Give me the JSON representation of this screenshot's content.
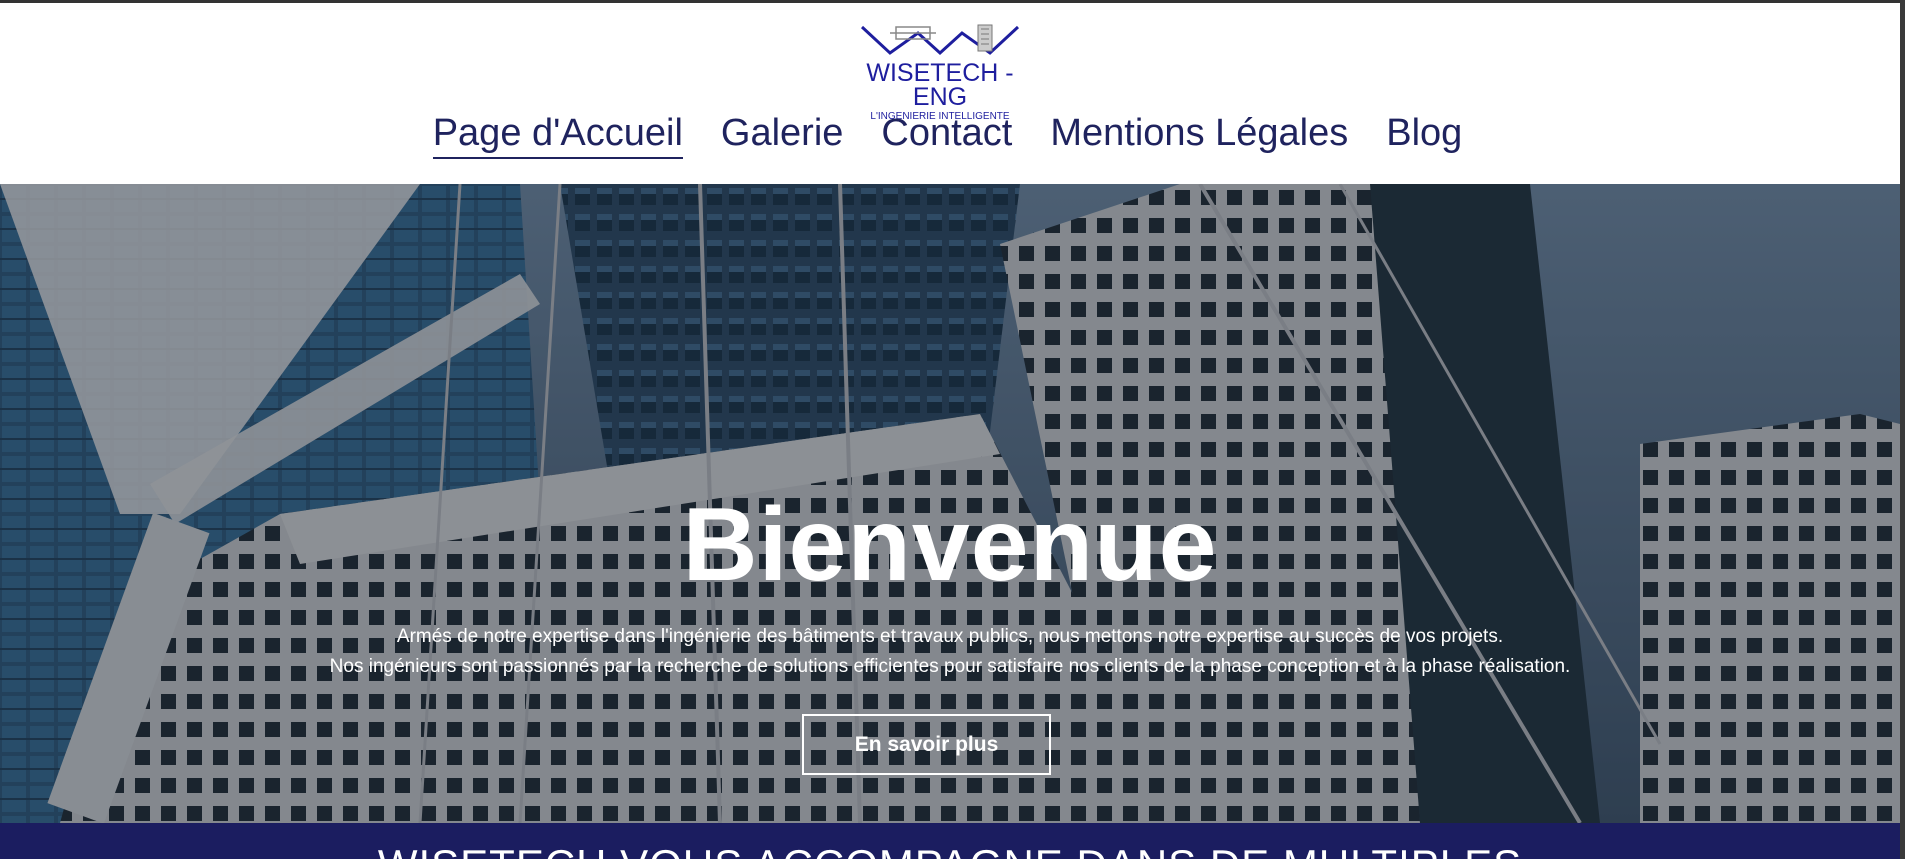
{
  "logo": {
    "name": "WISETECH - ENG",
    "tagline": "L'INGENIERIE INTELLIGENTE"
  },
  "nav": {
    "items": [
      {
        "label": "Page d'Accueil",
        "active": true
      },
      {
        "label": "Galerie",
        "active": false
      },
      {
        "label": "Contact",
        "active": false
      },
      {
        "label": "Mentions Légales",
        "active": false
      },
      {
        "label": "Blog",
        "active": false
      }
    ]
  },
  "hero": {
    "title": "Bienvenue",
    "line1": "Armés de notre expertise dans l'ingénierie des bâtiments et travaux publics, nous mettons notre expertise au succès de vos projets.",
    "line2": "Nos ingénieurs sont passionnés par la recherche de solutions efficientes pour satisfaire nos clients de la phase conception et à la phase réalisation.",
    "cta_label": "En savoir plus"
  },
  "band": {
    "text": "WISETECH VOUS ACCOMPAGNE DANS DE MULTIPLES"
  },
  "colors": {
    "nav_text": "#1f235e",
    "logo_blue": "#1e1e9e",
    "band_bg": "#1b1d60"
  }
}
